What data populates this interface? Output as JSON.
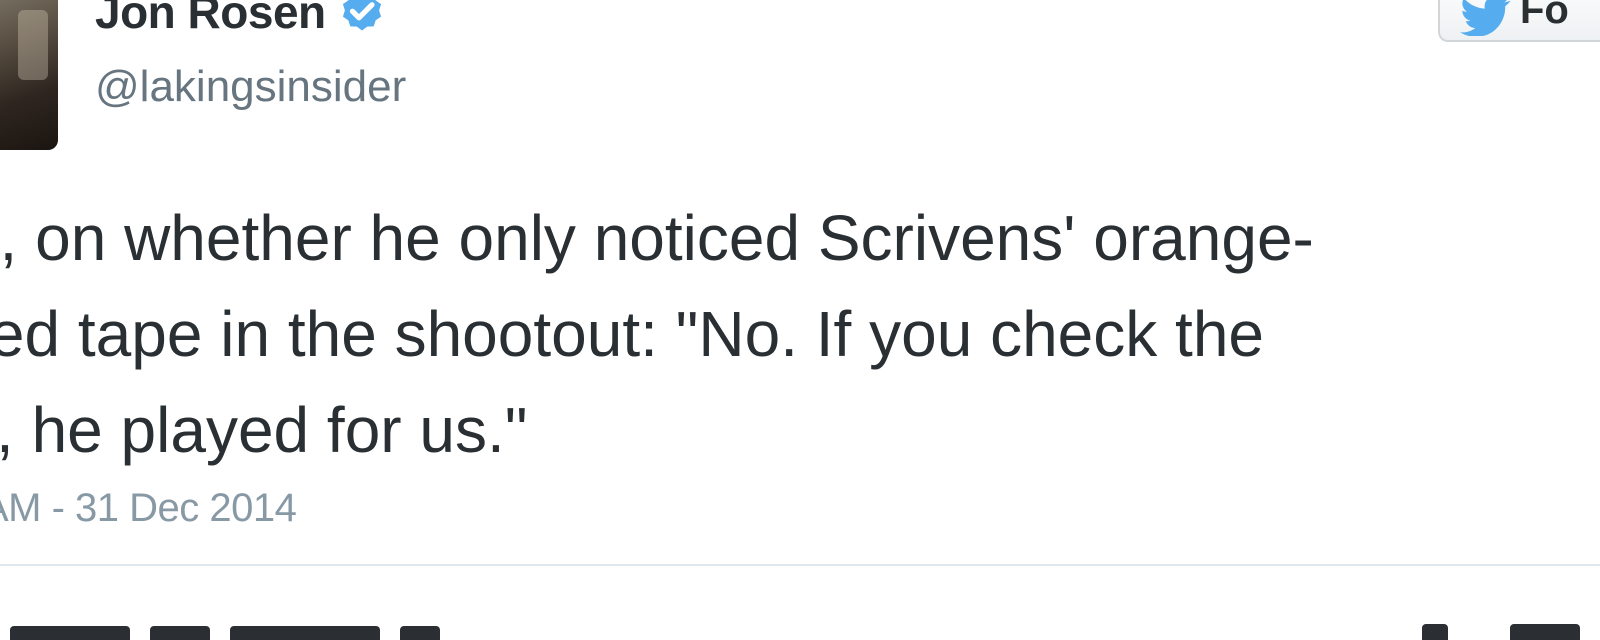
{
  "tweet": {
    "author": {
      "display_name": "Jon Rosen",
      "handle": "@lakingsinsider",
      "verified": true,
      "verified_color": "#55acee"
    },
    "follow_button": {
      "label": "Fo",
      "icon": "twitter-bird-icon",
      "icon_color": "#55acee"
    },
    "text": "ryl, on whether he only noticed Scrivens' orange-\nored tape in the shootout: \"No. If you check the\nks, he played for us.\"",
    "timestamp": "AM - 31 Dec 2014"
  },
  "colors": {
    "text": "#292f33",
    "secondary": "#66757f",
    "divider": "#e1e8ed"
  }
}
